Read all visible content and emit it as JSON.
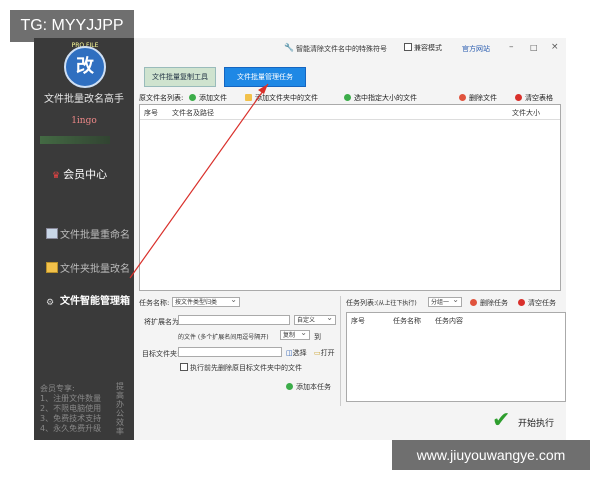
{
  "watermark": {
    "top_left": "TG: MYYJJPP",
    "bottom_right": "www.jiuyouwangye.com"
  },
  "sidebar": {
    "logo_text": "改",
    "logo_sub": "PRO FILE",
    "app_title": "文件批量改名高手",
    "user": "1ingo",
    "member_center": "会员中心",
    "items": [
      {
        "label": "文件批量重命名",
        "active": false
      },
      {
        "label": "文件夹批量改名",
        "active": false
      },
      {
        "label": "文件智能管理箱",
        "active": true
      }
    ],
    "footer_left": "会员专享:\n1、注册文件数量\n2、不限电脑使用\n3、免费技术支持\n4、永久免费升级",
    "footer_right": "提高办公效率"
  },
  "topbar": {
    "special_chars": "智能清除文件名中的特殊符号",
    "compat_mode": "兼容模式",
    "official_site": "官方网站",
    "win_min": "–",
    "win_max": "□",
    "win_close": "×"
  },
  "tabs": [
    {
      "label": "文件批量复制工具",
      "selected": false
    },
    {
      "label": "文件批量管理任务",
      "selected": true
    }
  ],
  "toolbar": {
    "list_label": "原文件名列表:",
    "add_file": "添加文件",
    "add_folder_files": "添加文件夹中的文件",
    "select_by_size": "选中指定大小的文件",
    "delete_file": "删除文件",
    "clear_table": "清空表格"
  },
  "file_table": {
    "columns": [
      "序号",
      "文件名及路径",
      "文件大小"
    ],
    "rows": []
  },
  "task_form": {
    "task_name_label": "任务名称:",
    "task_name_value": "按文件类型归类",
    "ext_label": "将扩展名为:",
    "ext_value": "",
    "custom_label": "自定义",
    "ext_hint": "的文件 (多个扩展名间用逗号隔开)",
    "action_value": "复制",
    "to_label": "到",
    "target_label": "目标文件夹:",
    "target_value": "",
    "choose_btn": "选择",
    "open_btn": "打开",
    "pre_delete_label": "执行前先删除原目标文件夹中的文件",
    "add_task_btn": "添加本任务"
  },
  "task_list": {
    "label": "任务列表:",
    "order_label": "(从上往下执行)",
    "group_value": "分组一",
    "delete_task": "删除任务",
    "clear_task": "清空任务",
    "columns": [
      "序号",
      "任务名称",
      "任务内容"
    ],
    "rows": []
  },
  "run_button": "开始执行",
  "colors": {
    "accent": "#1e88e5",
    "sidebar_bg": "#3a3a3a",
    "annotation_arrow": "#d9302b"
  }
}
